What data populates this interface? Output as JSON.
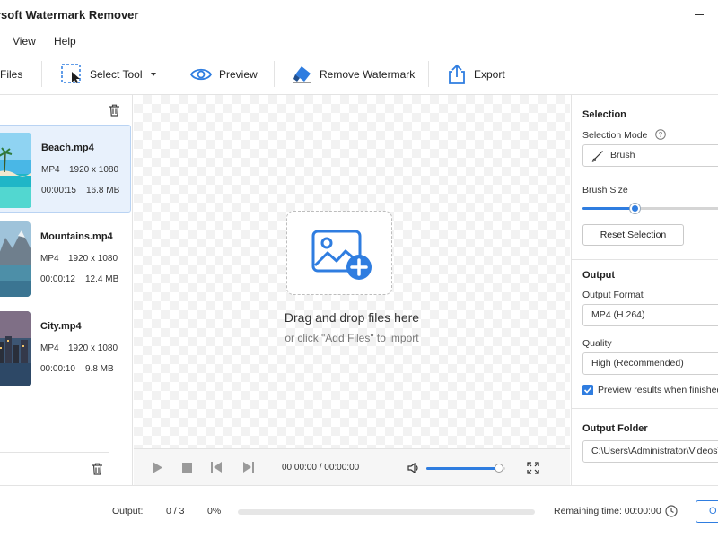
{
  "window": {
    "title": "rsoft Watermark Remover"
  },
  "menu": {
    "items": [
      "View",
      "Help"
    ]
  },
  "toolbar": {
    "add_files_label": "Files",
    "select_tool_label": "Select Tool",
    "preview_label": "Preview",
    "remove_watermark_label": "Remove Watermark",
    "export_label": "Export"
  },
  "files": [
    {
      "name": "Beach.mp4",
      "format": "MP4",
      "resolution": "1920 x 1080",
      "duration": "00:00:15",
      "size": "16.8 MB",
      "selected": true
    },
    {
      "name": "Mountains.mp4",
      "format": "MP4",
      "resolution": "1920 x 1080",
      "duration": "00:00:12",
      "size": "12.4 MB",
      "selected": false
    },
    {
      "name": "City.mp4",
      "format": "MP4",
      "resolution": "1920 x 1080",
      "duration": "00:00:10",
      "size": "9.8 MB",
      "selected": false
    }
  ],
  "preview": {
    "drop_title": "Drag and drop files here",
    "drop_subtitle": "or click \"Add Files\" to import"
  },
  "player": {
    "current_time": "00:00:00",
    "separator": "/",
    "total_time": "00:00:00",
    "volume": 0.92
  },
  "settings": {
    "selection": {
      "heading": "Selection",
      "mode_label": "Selection Mode",
      "mode_value": "Brush",
      "brush_size_label": "Brush Size",
      "brush_size_level": 0.37,
      "reset_label": "Reset Selection"
    },
    "output": {
      "heading": "Output",
      "format_label": "Output Format",
      "format_value": "MP4 (H.264)",
      "quality_label": "Quality",
      "quality_value": "High (Recommended)",
      "preview_checkbox_label": "Preview results when finished",
      "preview_checked": true
    },
    "folder": {
      "heading": "Output Folder",
      "path": "C:\\Users\\Administrator\\Videos\\"
    }
  },
  "status": {
    "output_label": "Output:",
    "count": "0 / 3",
    "percent": "0%",
    "progress": 0,
    "remaining": "Remaining time: 00:00:00",
    "action_label": "O"
  },
  "colors": {
    "accent": "#2f7de0",
    "selected_bg": "#e8f1fc"
  }
}
